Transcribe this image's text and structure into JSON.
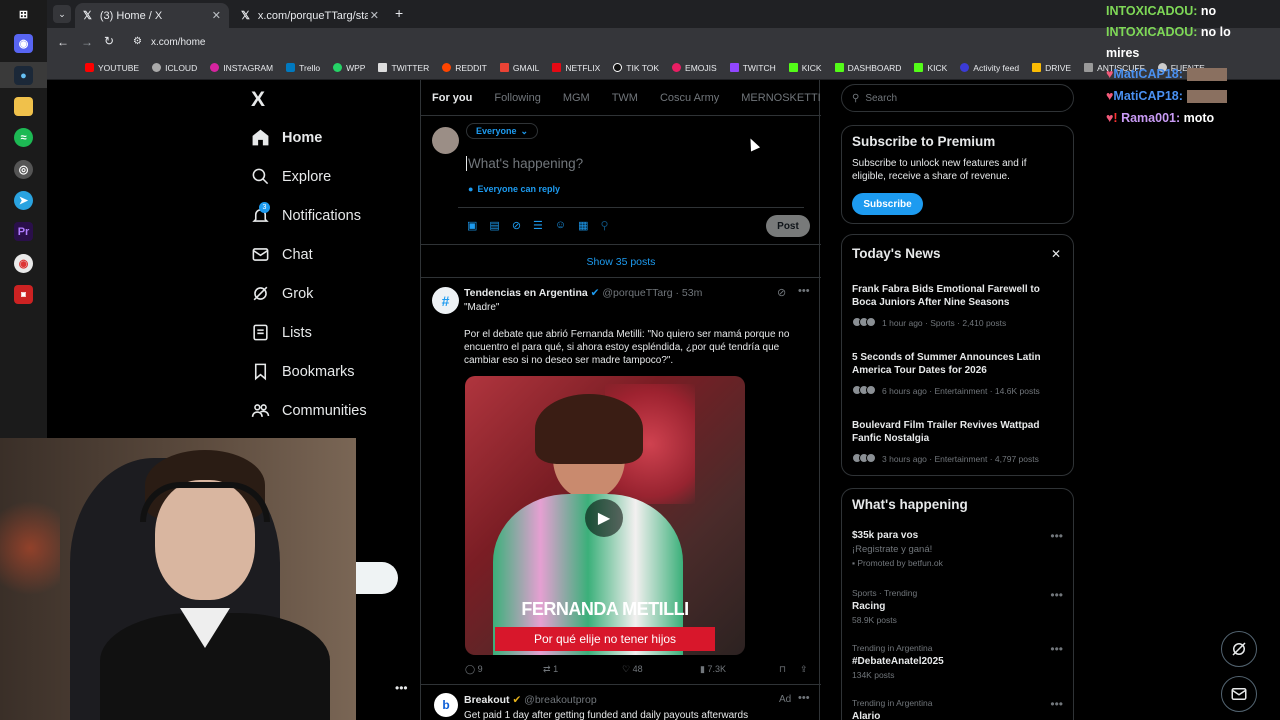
{
  "browser": {
    "tabs": [
      {
        "label": "(3) Home / X"
      },
      {
        "label": "x.com/porqueTTarg/status/199..."
      }
    ],
    "url": "x.com/home",
    "bookmarks": [
      "YOUTUBE",
      "ICLOUD",
      "INSTAGRAM",
      "Trello",
      "WPP",
      "TWITTER",
      "REDDIT",
      "GMAIL",
      "NETFLIX",
      "TIK TOK",
      "EMOJIS",
      "TWITCH",
      "KICK",
      "DASHBOARD",
      "KICK",
      "Activity feed",
      "DRIVE",
      "ANTISCUFF",
      "FUENTE"
    ]
  },
  "nav": {
    "logo": "X",
    "items": [
      {
        "label": "Home",
        "icon": "home-icon"
      },
      {
        "label": "Explore",
        "icon": "search-icon"
      },
      {
        "label": "Notifications",
        "icon": "bell-icon",
        "badge": "3"
      },
      {
        "label": "Chat",
        "icon": "mail-icon"
      },
      {
        "label": "Grok",
        "icon": "grok-icon"
      },
      {
        "label": "Lists",
        "icon": "list-icon"
      },
      {
        "label": "Bookmarks",
        "icon": "bookmark-icon"
      },
      {
        "label": "Communities",
        "icon": "communities-icon"
      }
    ]
  },
  "feed": {
    "tabs": [
      "For you",
      "Following",
      "MGM",
      "TWM",
      "Coscu Army",
      "MERNOSKETTI",
      "S"
    ],
    "composer": {
      "audience": "Everyone",
      "placeholder": "What's happening?",
      "reply_setting": "Everyone can reply",
      "post_button": "Post"
    },
    "show_posts": "Show 35 posts",
    "post": {
      "author": "Tendencias en Argentina",
      "handle": "@porqueTTarg",
      "time": "53m",
      "title": "\"Madre\"",
      "text": "Por el debate que abrió Fernanda Metilli: \"No quiero ser mamá porque no encuentro el para qué, si ahora estoy espléndida, ¿por qué tendría que cambiar eso si no deseo ser madre tampoco?\".",
      "video_name": "FERNANDA METILLI",
      "video_caption": "Por qué elije no tener hijos",
      "replies": "9",
      "reposts": "1",
      "likes": "48",
      "views": "7.3K"
    },
    "ad": {
      "author": "Breakout",
      "handle": "@breakoutprop",
      "label": "Ad",
      "text": "Get paid 1 day after getting funded and daily payouts afterwards"
    }
  },
  "sidebar": {
    "search_placeholder": "Search",
    "premium": {
      "title": "Subscribe to Premium",
      "text": "Subscribe to unlock new features and if eligible, receive a share of revenue.",
      "button": "Subscribe"
    },
    "news": {
      "title": "Today's News",
      "items": [
        {
          "title": "Frank Fabra Bids Emotional Farewell to Boca Juniors After Nine Seasons",
          "meta": "1 hour ago · Sports · 2,410 posts"
        },
        {
          "title": "5 Seconds of Summer Announces Latin America Tour Dates for 2026",
          "meta": "6 hours ago · Entertainment · 14.6K posts"
        },
        {
          "title": "Boulevard Film Trailer Revives Wattpad Fanfic Nostalgia",
          "meta": "3 hours ago · Entertainment · 4,797 posts"
        }
      ]
    },
    "happening": {
      "title": "What's happening",
      "items": [
        {
          "category": "",
          "name": "$35k para vos",
          "sub": "¡Registrate y ganá!",
          "meta": "Promoted by betfun.ok"
        },
        {
          "category": "Sports · Trending",
          "name": "Racing",
          "sub": "",
          "meta": "58.9K posts"
        },
        {
          "category": "Trending in Argentina",
          "name": "#DebateAnatel2025",
          "sub": "",
          "meta": "134K posts"
        },
        {
          "category": "Trending in Argentina",
          "name": "Alario",
          "sub": "",
          "meta": ""
        }
      ]
    }
  },
  "chat_overlay": [
    {
      "user": "INTOXICADOU:",
      "message": "no"
    },
    {
      "user": "INTOXICADOU:",
      "message": "no lo"
    },
    {
      "user": "",
      "message": "mires"
    },
    {
      "user": "MatiCAP18:",
      "message": ""
    },
    {
      "user": "MatiCAP18:",
      "message": ""
    },
    {
      "user": "Rama001:",
      "message": "moto"
    }
  ],
  "colors": {
    "accent": "#1d9bf0",
    "background": "#000000",
    "border": "#2f3336",
    "muted": "#71767b",
    "chat_user": "#4a90f0",
    "chat_rama": "#c99bf5",
    "chat_intox": "#7fd957"
  }
}
